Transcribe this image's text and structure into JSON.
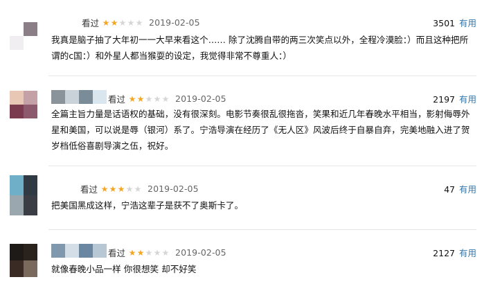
{
  "reviews": [
    {
      "watched_label": "看过",
      "rating": 2,
      "date": "2019-02-05",
      "votes": "3501",
      "useful_label": "有用",
      "text": "我真是脑子抽了大年初一一大早来看这个…… 除了沈腾自带的两三次笑点以外，全程冷漠脸：）而且这种把所谓的c国：）和外星人都当猴耍的设定，我觉得非常不尊重人：）",
      "avatar_colors": [
        "#ffffff",
        "#8c7e86",
        "#f0eef0",
        "#ffffff"
      ]
    },
    {
      "watched_label": "看过",
      "rating": 2,
      "date": "2019-02-05",
      "votes": "2197",
      "useful_label": "有用",
      "text": "全篇主旨力量是话语权的基础，没有很深刻。电影节奏很乱很拖沓，笑果和近几年春晚水平相当，影射侮辱外星和美国，可以说是辱（银河）系了。宁浩导演在经历了《无人区》风波后终于自暴自弃，完美地融入进了贺岁档低俗喜剧导演之伍，祝好。",
      "avatar_colors": [
        "#e8c7b4",
        "#c4a1a6",
        "#7c3a4e",
        "#8c5a6c"
      ]
    },
    {
      "watched_label": "看过",
      "rating": 3,
      "date": "2019-02-05",
      "votes": "47",
      "useful_label": "有用",
      "text": "把美国黑成这样，宁浩这辈子是获不了奥斯卡了。",
      "avatar_colors": [
        "#6fb0c8",
        "#2f3a44",
        "#9aa7ae",
        "#3a3d44"
      ]
    },
    {
      "watched_label": "看过",
      "rating": 2,
      "date": "2019-02-05",
      "votes": "2127",
      "useful_label": "有用",
      "text": "就像春晚小品一样 你很想笑 却不好笑",
      "avatar_colors": [
        "#1e1a18",
        "#2a221d",
        "#3a2c24",
        "#7a6a5e"
      ]
    }
  ]
}
